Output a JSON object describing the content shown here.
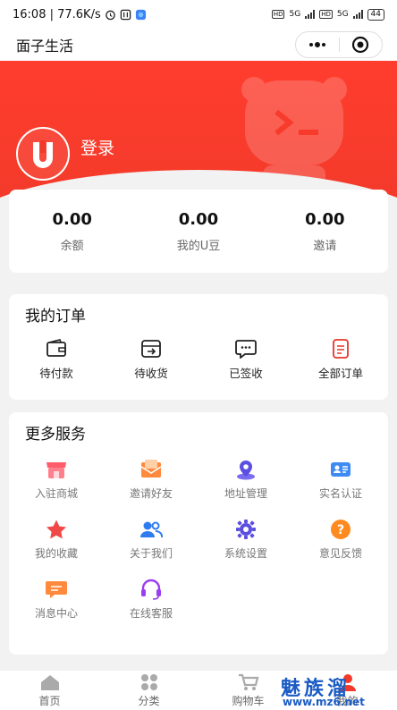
{
  "status_bar": {
    "time_speed": "16:08 | 77.6K/s",
    "net1": "5G",
    "net2": "5G",
    "battery": "44"
  },
  "header": {
    "app_title": "面子生活"
  },
  "hero": {
    "login_label": "登录",
    "bg_color": "#f23a2a"
  },
  "balances": [
    {
      "value": "0.00",
      "label": "余额"
    },
    {
      "value": "0.00",
      "label": "我的U豆"
    },
    {
      "value": "0.00",
      "label": "邀请"
    }
  ],
  "orders": {
    "title": "我的订单",
    "items": [
      {
        "label": "待付款",
        "icon": "wallet-icon"
      },
      {
        "label": "待收货",
        "icon": "receive-box-icon"
      },
      {
        "label": "已签收",
        "icon": "chat-dots-icon"
      },
      {
        "label": "全部订单",
        "icon": "document-list-icon"
      }
    ]
  },
  "services": {
    "title": "更多服务",
    "items": [
      {
        "label": "入驻商城",
        "icon": "storefront-icon"
      },
      {
        "label": "邀请好友",
        "icon": "envelope-icon"
      },
      {
        "label": "地址管理",
        "icon": "location-pin-icon"
      },
      {
        "label": "实名认证",
        "icon": "id-card-icon"
      },
      {
        "label": "我的收藏",
        "icon": "star-icon"
      },
      {
        "label": "关于我们",
        "icon": "users-icon"
      },
      {
        "label": "系统设置",
        "icon": "gear-icon"
      },
      {
        "label": "意见反馈",
        "icon": "question-icon"
      },
      {
        "label": "消息中心",
        "icon": "message-icon"
      },
      {
        "label": "在线客服",
        "icon": "headset-icon"
      }
    ]
  },
  "tabbar": {
    "items": [
      {
        "label": "首页",
        "icon": "home-icon"
      },
      {
        "label": "分类",
        "icon": "grid-icon"
      },
      {
        "label": "购物车",
        "icon": "cart-icon"
      },
      {
        "label": "我的",
        "icon": "user-icon"
      }
    ]
  },
  "watermark": {
    "big": "魅族溜",
    "small": "www.mz6.net"
  }
}
